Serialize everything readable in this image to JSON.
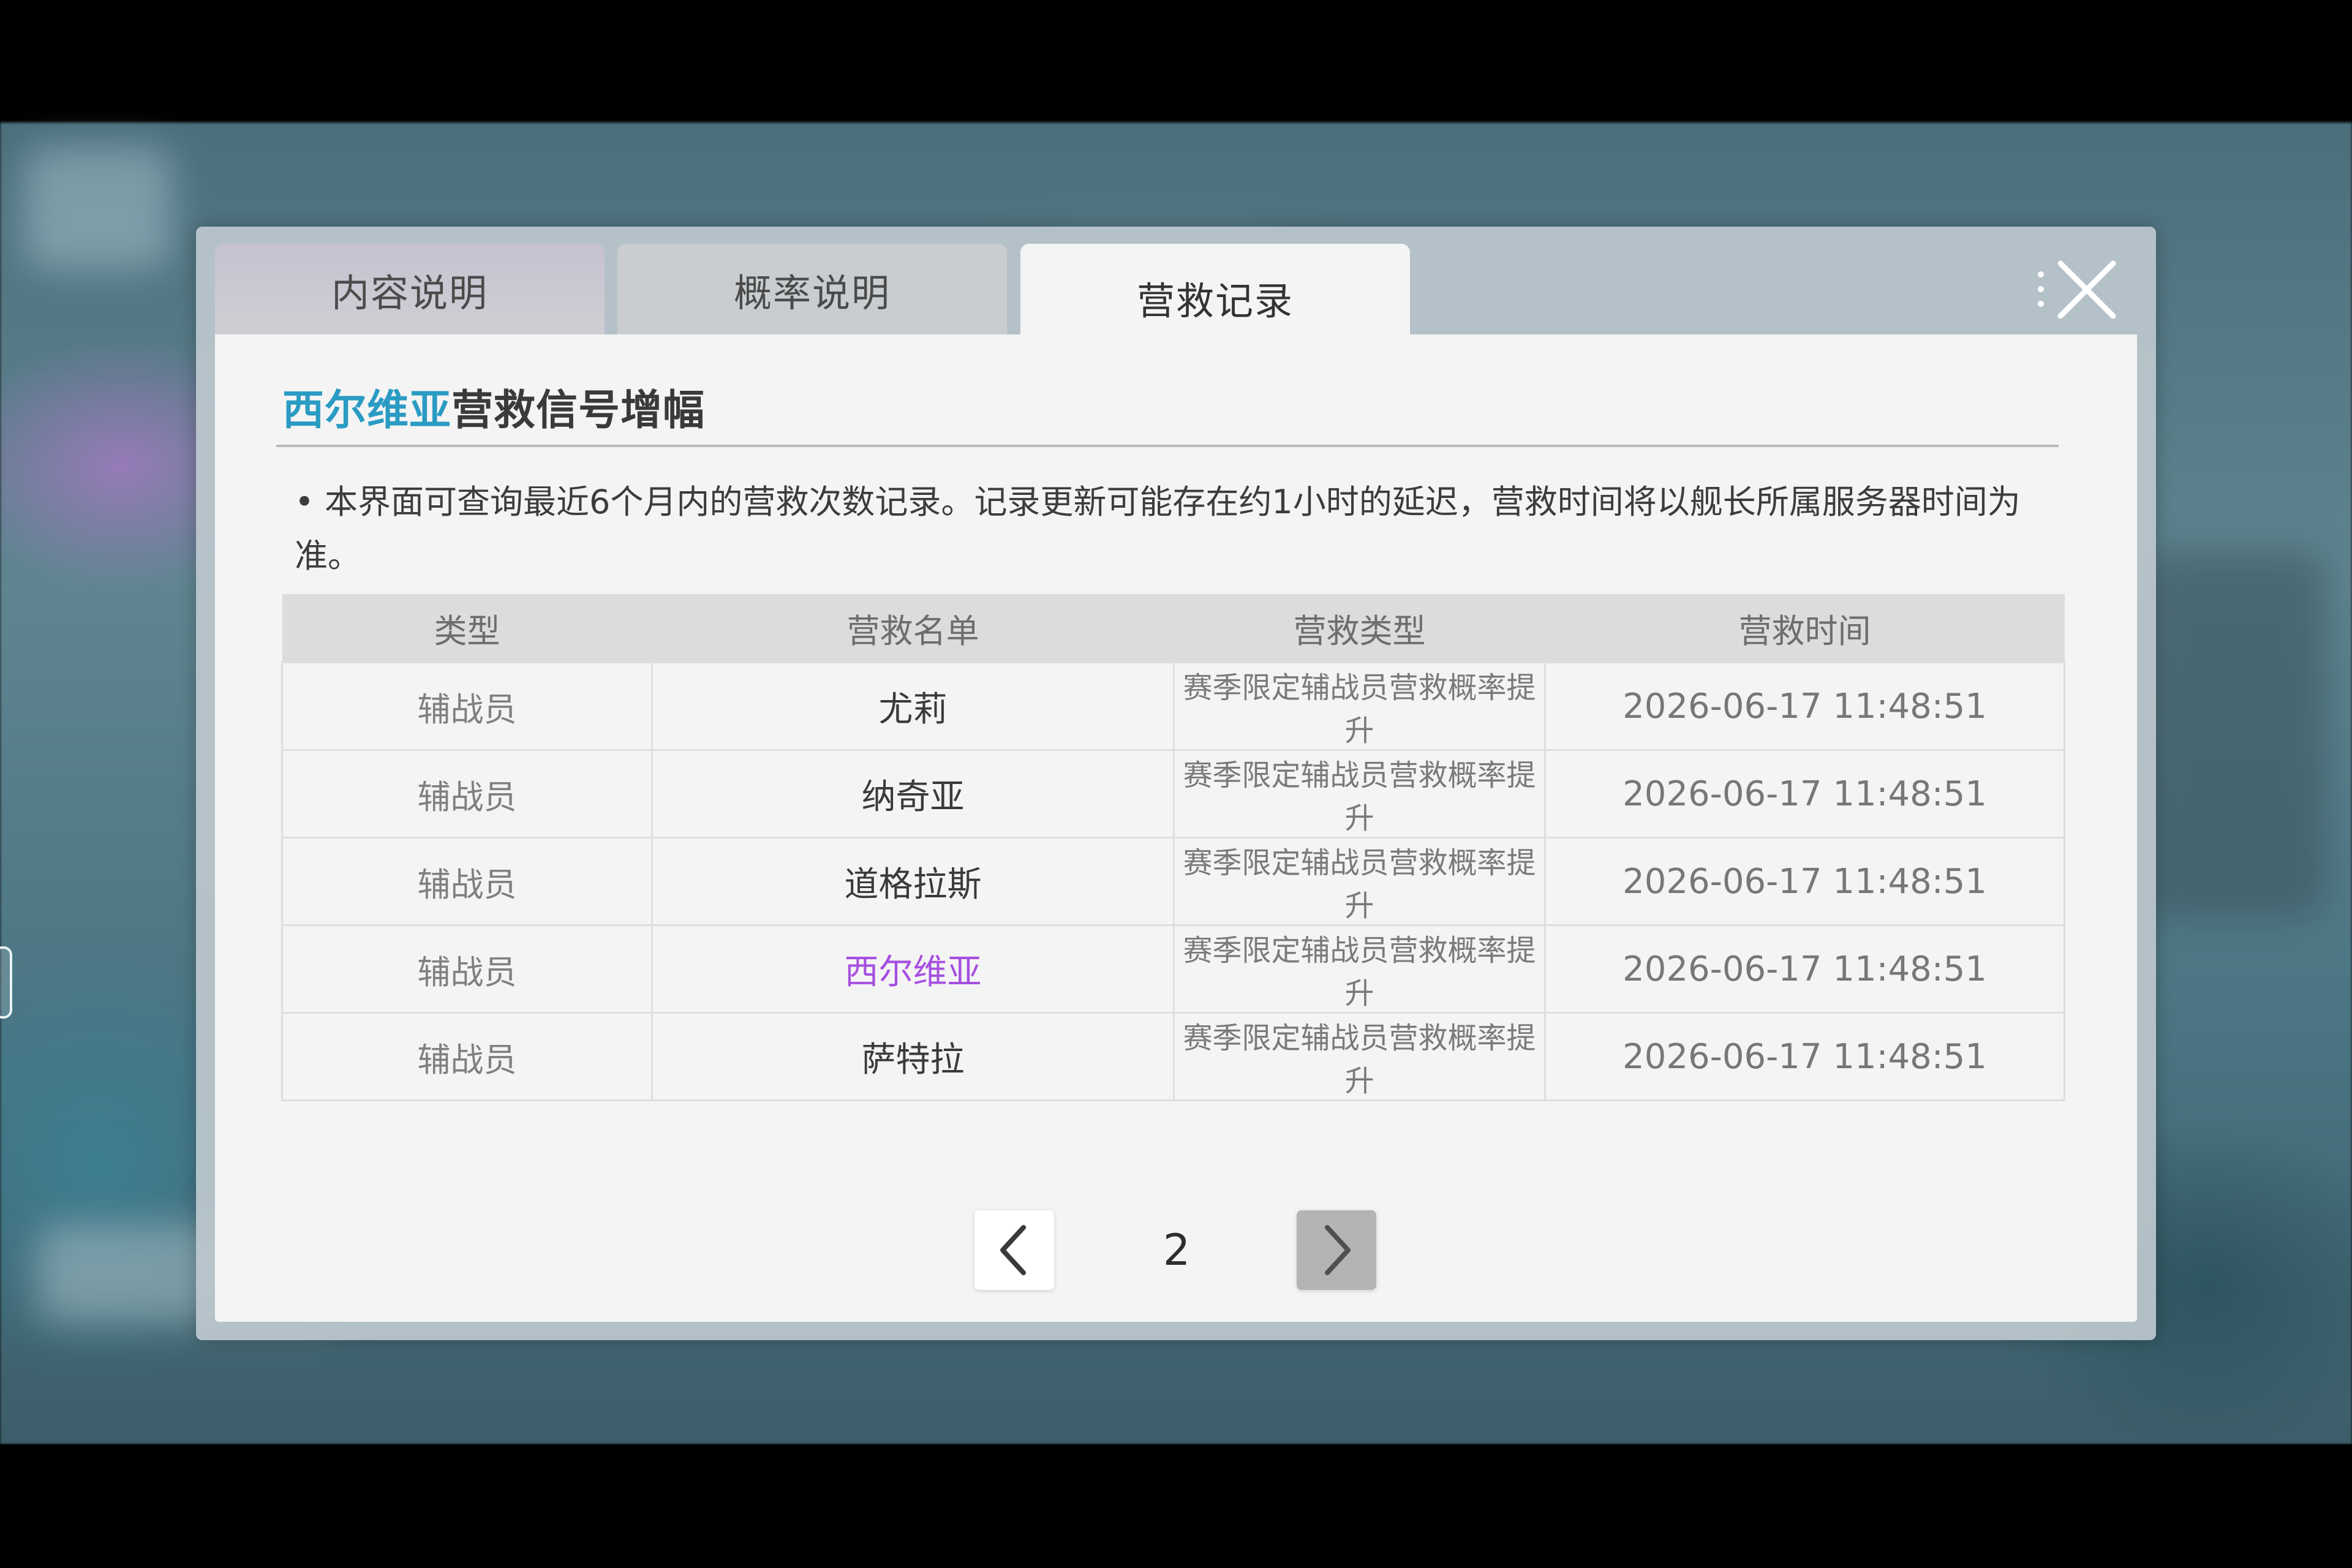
{
  "tabs": [
    {
      "label": "内容说明",
      "active": false
    },
    {
      "label": "概率说明",
      "active": false
    },
    {
      "label": "营救记录",
      "active": true
    }
  ],
  "panel": {
    "title_highlight": "西尔维亚",
    "title_rest": "营救信号增幅",
    "notice": "• 本界面可查询最近6个月内的营救次数记录。记录更新可能存在约1小时的延迟，营救时间将以舰长所属服务器时间为准。"
  },
  "table": {
    "headers": [
      "类型",
      "营救名单",
      "营救类型",
      "营救时间"
    ],
    "rows": [
      {
        "type": "辅战员",
        "name": "尤莉",
        "rescue_type": "赛季限定辅战员营救概率提升",
        "time": "2026-06-17 11:48:51"
      },
      {
        "type": "辅战员",
        "name": "纳奇亚",
        "rescue_type": "赛季限定辅战员营救概率提升",
        "time": "2026-06-17 11:48:51"
      },
      {
        "type": "辅战员",
        "name": "道格拉斯",
        "rescue_type": "赛季限定辅战员营救概率提升",
        "time": "2026-06-17 11:48:51"
      },
      {
        "type": "辅战员",
        "name": "西尔维亚",
        "rescue_type": "赛季限定辅战员营救概率提升",
        "time": "2026-06-17 11:48:51"
      },
      {
        "type": "辅战员",
        "name": "萨特拉",
        "rescue_type": "赛季限定辅战员营救概率提升",
        "time": "2026-06-17 11:48:51"
      }
    ]
  },
  "pagination": {
    "current_page": "2"
  },
  "colors": {
    "title_highlight": "#2a9bc3",
    "special_name": "#a64fe0",
    "panel_bg": "#f4f4f4"
  },
  "icons": {
    "close": "close-icon",
    "prev": "chevron-left-icon",
    "next": "chevron-right-icon"
  }
}
